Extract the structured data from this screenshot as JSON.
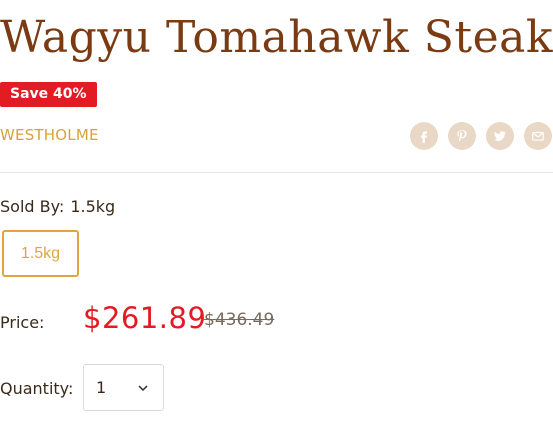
{
  "product": {
    "title": "Wagyu Tomahawk Steak",
    "badge": "Save 40%",
    "vendor": "WESTHOLME"
  },
  "share": {
    "icons": [
      "facebook-icon",
      "pinterest-icon",
      "twitter-icon",
      "email-icon"
    ]
  },
  "variant": {
    "label": "Sold By:",
    "selected": "1.5kg",
    "options": [
      "1.5kg"
    ]
  },
  "price": {
    "label": "Price:",
    "current": "$261.89",
    "compare": "$436.49"
  },
  "quantity": {
    "label": "Quantity:",
    "value": "1"
  },
  "colors": {
    "title": "#7a3a12",
    "badge": "#e31b23",
    "accent": "#e0a540",
    "share_bg": "#ead8c6"
  }
}
